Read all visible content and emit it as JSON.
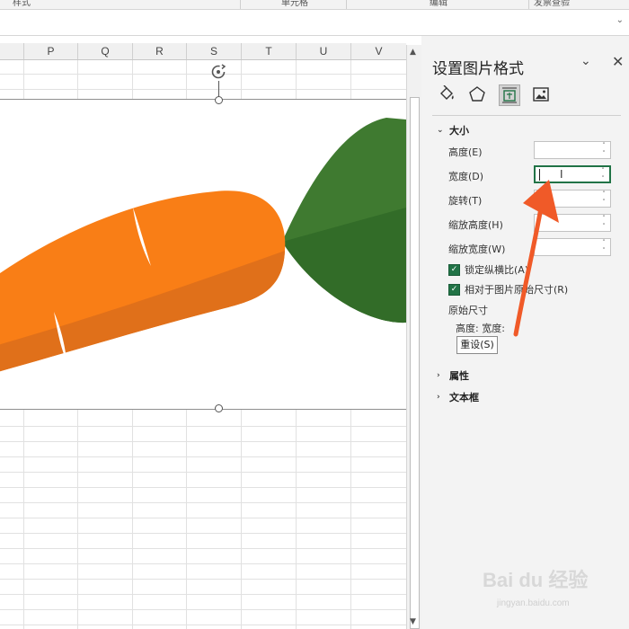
{
  "ribbon": {
    "groups": [
      "样式",
      "单元格",
      "编辑",
      "发票查验"
    ]
  },
  "sheet": {
    "columns": [
      "P",
      "Q",
      "R",
      "S",
      "T",
      "U",
      "V"
    ]
  },
  "pane": {
    "title": "设置图片格式",
    "tabs": [
      "fill-line",
      "effects",
      "size-properties",
      "picture"
    ],
    "active_tab": "size-properties",
    "sections": {
      "size": {
        "label": "大小",
        "expanded": true,
        "fields": {
          "height": {
            "label": "高度(E)",
            "value": ""
          },
          "width": {
            "label": "宽度(D)",
            "value": ""
          },
          "rotation": {
            "label": "旋转(T)",
            "value": ""
          },
          "scale_height": {
            "label": "缩放高度(H)",
            "value": ""
          },
          "scale_width": {
            "label": "缩放宽度(W)",
            "value": ""
          }
        },
        "lock_aspect": {
          "label": "锁定纵横比(A)",
          "checked": true
        },
        "relative_original": {
          "label": "相对于图片原始尺寸(R)",
          "checked": true
        },
        "original_size_label": "原始尺寸",
        "original_dims": "高度:   宽度:",
        "reset_label": "重设(S)"
      },
      "properties": {
        "label": "属性",
        "expanded": false
      },
      "textbox": {
        "label": "文本框",
        "expanded": false
      }
    }
  },
  "colors": {
    "accent": "#217346",
    "carrot_orange": "#f97e16",
    "carrot_shade": "#e0701a",
    "leaf_green": "#3f7a30",
    "leaf_shade": "#326c28",
    "annotation_arrow": "#f05a28"
  },
  "watermark": {
    "logo": "Bai du 经验",
    "url": "jingyan.baidu.com"
  }
}
